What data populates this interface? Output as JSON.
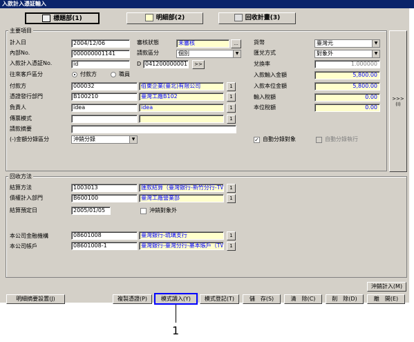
{
  "window": {
    "title": "入款計入憑証輸入"
  },
  "tabs": [
    {
      "label": "標題部(1)"
    },
    {
      "label": "明細部(2)"
    },
    {
      "label": "回收計畫(3)"
    }
  ],
  "main_group": {
    "title": "主要項目",
    "entry_date": {
      "label": "計入日",
      "value": "2004/12/06"
    },
    "review_status": {
      "label": "審核狀態",
      "value": "未審核",
      "button": "..."
    },
    "internal_no": {
      "label": "內部No.",
      "value": "000000001141"
    },
    "voucher_type": {
      "label": "請款區分",
      "value": "個別"
    },
    "entry_no": {
      "label": "入款計入憑証No.",
      "value": "id",
      "d_label": "D",
      "d_value": "041200000001",
      "button": ">>"
    },
    "counterparty_type": {
      "label": "往來客戶區分",
      "option1": "付款方",
      "option2": "職員"
    },
    "payer": {
      "label": "付款方",
      "code": "000032",
      "name": "伯東企業(臺北)有限公司",
      "button": "1"
    },
    "issuing_dept": {
      "label": "憑證發行部門",
      "code": "B100210",
      "name": "臺灣工廠B102",
      "button": "1"
    },
    "person_in_charge": {
      "label": "負責人",
      "code": "idea",
      "name": "idea",
      "button": "1"
    },
    "template": {
      "label": "傳票模式",
      "code": "",
      "name": "",
      "button": "1"
    },
    "summary": {
      "label": "請款摘要",
      "value": ""
    },
    "amount_type": {
      "label": "(-)金額分錄區分",
      "value": "沖銷分錄"
    },
    "currency": {
      "label": "貨幣",
      "value": "臺灣元"
    },
    "exchange_method": {
      "label": "匯兌方式",
      "value": "對象外"
    },
    "exchange_rate": {
      "label": "兌換率",
      "value": "1.000000"
    },
    "input_amount": {
      "label": "入款輸入金額",
      "value": "5,800.00"
    },
    "base_amount": {
      "label": "入款本位金額",
      "value": "5,800.00"
    },
    "input_tax": {
      "label": "輸入稅額",
      "value": "0.00"
    },
    "base_tax": {
      "label": "本位稅額",
      "value": "0.00"
    },
    "auto_entry_target": {
      "label": "自動分錄對象",
      "checked": true
    },
    "auto_entry_exec": {
      "label": "自動分錄執行",
      "checked": false
    },
    "side_button": ">>>\n(I)"
  },
  "collection_group": {
    "title": "回收方法",
    "settlement_method": {
      "label": "結算方法",
      "code": "1003013",
      "name": "匯款結算（臺灣銀行-新竹分行-TWD）",
      "button": "1"
    },
    "creditor_dept": {
      "label": "債權計入部門",
      "code": "B600100",
      "name": "臺灣工廠營業部",
      "button": "1"
    },
    "settlement_date": {
      "label": "結算預定日",
      "value": "2005/01/05"
    },
    "offset_exclusion": {
      "label": "沖銷對象外",
      "checked": false
    },
    "bank": {
      "label": "本公司金融機構",
      "code": "08601008",
      "name": "臺灣銀行-琉璃支行",
      "button": "1"
    },
    "account": {
      "label": "本公司帳戶",
      "code": "08601008-1",
      "name": "臺灣銀行-臺灣分行-基本賬戶（TWD）",
      "button": "1"
    }
  },
  "buttons": {
    "offset_entry": "沖銷計入(M)",
    "detail_summary": "明細摘要設置(J)",
    "copy_voucher": "複製憑證(P)",
    "pattern_input": "模式讀入(Y)",
    "pattern_register": "模式登記(T)",
    "save": "儲　存(S)",
    "clear": "清　除(C)",
    "delete": "削　除(D)",
    "close": "離　開(E)"
  },
  "annotation": {
    "label": "1"
  },
  "colors": {
    "readonly_bg": "#ffffcc",
    "readonly_text": "#0000ff",
    "highlight_border": "#0000ff",
    "title_bg": "#0a246a"
  }
}
